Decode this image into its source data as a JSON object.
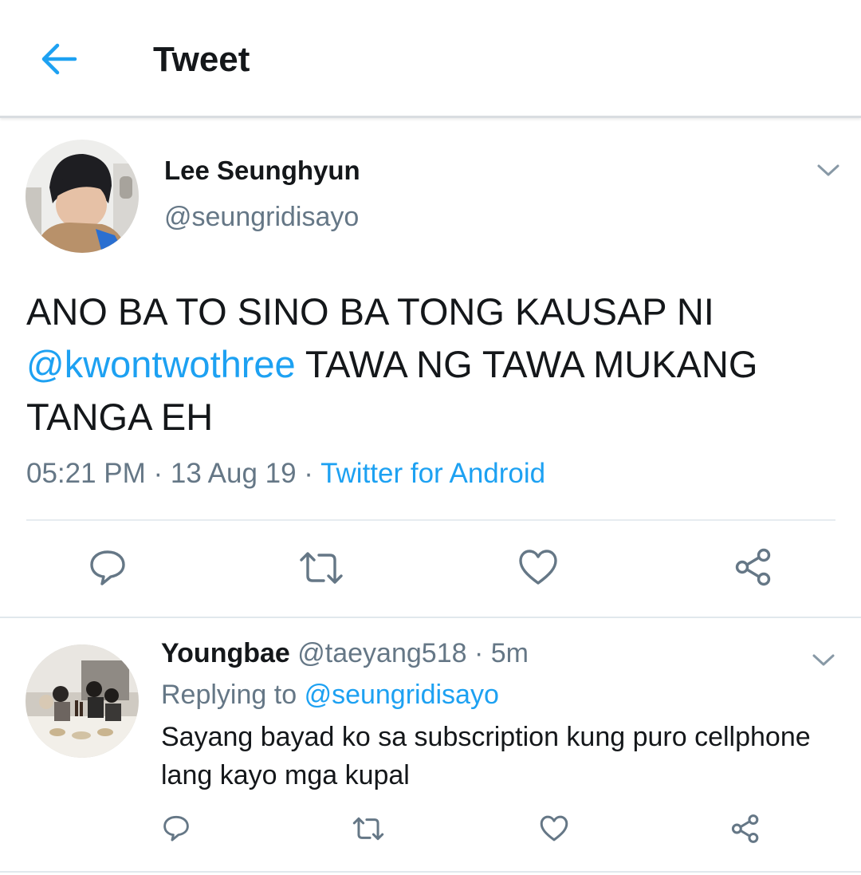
{
  "header": {
    "title": "Tweet",
    "back_icon": "arrow-left-icon",
    "accent": "#1da1f2"
  },
  "tweet": {
    "author_name": "Lee Seunghyun",
    "author_handle": "@seungridisayo",
    "text_part1": "ANO BA TO SINO BA TONG KAUSAP NI",
    "mention": "@kwontwothree",
    "text_part2": " TAWA NG TAWA MUKANG TANGA EH",
    "time": "05:21 PM",
    "date": "13 Aug 19",
    "separator": " · ",
    "source": "Twitter for Android",
    "actions": [
      "reply-icon",
      "retweet-icon",
      "like-icon",
      "share-icon"
    ]
  },
  "reply": {
    "author_name": "Youngbae",
    "author_handle": "@taeyang518",
    "time_ago": "5m",
    "replying_label": "Replying to",
    "replying_to": "@seungridisayo",
    "text": "Sayang bayad ko sa subscription kung puro cellphone lang kayo mga kupal",
    "actions": [
      "reply-icon",
      "retweet-icon",
      "like-icon",
      "share-icon"
    ]
  },
  "colors": {
    "text_primary": "#14171a",
    "text_secondary": "#657786",
    "link": "#1da1f2",
    "icon_gray": "#657786",
    "divider": "#e6ecf0"
  }
}
